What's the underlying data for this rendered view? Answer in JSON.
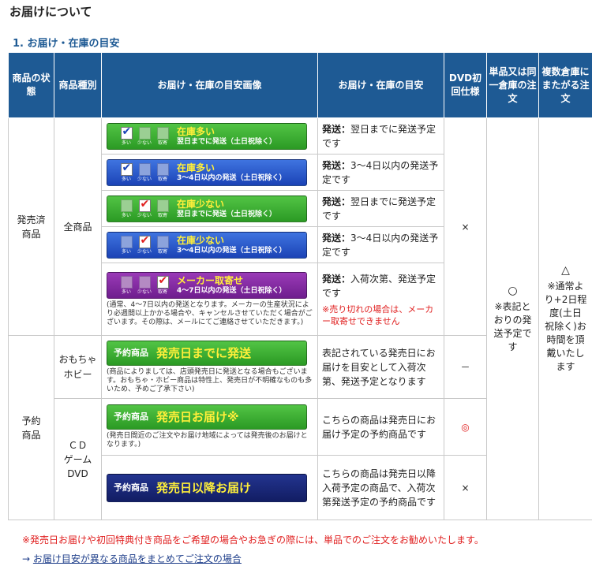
{
  "page": {
    "title": "お届けについて",
    "section_title": "1. お届け・在庫の目安"
  },
  "header": {
    "status": "商品の状態",
    "category": "商品種別",
    "image": "お届け・在庫の目安画像",
    "guide": "お届け・在庫の目安",
    "dvd": "DVD初回仕様",
    "single": "単品又は同一倉庫の注文",
    "multi": "複数倉庫にまたがる注文"
  },
  "released": {
    "status": "発売済商品",
    "category": "全商品",
    "box_labels": [
      "多い",
      "少ない",
      "取寄"
    ],
    "rows": [
      {
        "badge_main": "在庫多い",
        "badge_sub": "翌日までに発送（土日祝除く）",
        "desc_bold": "発送：",
        "desc": "翌日までに発送予定です"
      },
      {
        "badge_main": "在庫多い",
        "badge_sub": "3～4日以内の発送（土日祝除く）",
        "desc_bold": "発送：",
        "desc": "3～4日以内の発送予定です"
      },
      {
        "badge_main": "在庫少ない",
        "badge_sub": "翌日までに発送（土日祝除く）",
        "desc_bold": "発送：",
        "desc": "翌日までに発送予定です"
      },
      {
        "badge_main": "在庫少ない",
        "badge_sub": "3～4日以内の発送（土日祝除く）",
        "desc_bold": "発送：",
        "desc": "3～4日以内の発送予定です"
      },
      {
        "badge_main": "メーカー取寄せ",
        "badge_sub": "4～7日以内の発送（土日祝除く）",
        "desc_bold": "発送：",
        "desc": "入荷次第、発送予定です",
        "note": "(通常、4～7日以内の発送となります。メーカーの生産状況により必週間以上かかる場合や、キャンセルさせていただく場合がございます。その際は、メールにてご連絡させていただきます。)",
        "red": "※売り切れの場合は、メーカー取寄せできません"
      }
    ],
    "dvd": "×",
    "single": "○\n※表記とおりの発送予定です",
    "multi": "△\n※通常より+2日程度(土日祝除く)お時間を頂戴いたします"
  },
  "preorder": {
    "status": "予約商品",
    "rows": [
      {
        "category": "おもちゃ\nホビー",
        "badge_pre": "予約商品",
        "badge_main": "発売日までに発送",
        "note": "(商品によりましては、店頭発売日に発送となる場合もございます。おもちゃ・ホビー商品は特性上、発売日が不明確なものも多いため、予めご了承下さい)",
        "desc": "表記されている発売日にお届けを目安として入荷次第、発送予定となります",
        "dvd": "－"
      },
      {
        "category": "ＣＤ\nゲーム\nDVD",
        "badge_pre": "予約商品",
        "badge_main": "発売日お届け※",
        "note": "(発売日間近のご注文やお届け地域によっては発売後のお届けとなります。)",
        "desc": "こちらの商品は発売日にお届け予定の予約商品です",
        "dvd": "◎"
      },
      {
        "badge_pre": "予約商品",
        "badge_main": "発売日以降お届け",
        "desc": "こちらの商品は発売日以降入荷予定の商品で、入荷次第発送予定の予約商品です",
        "dvd": "×"
      }
    ]
  },
  "footer": {
    "note": "※発売日お届けや初回特典付き商品をご希望の場合やお急ぎの際には、単品でのご注文をお勧めいたします。",
    "link_arrow": "→",
    "link_text": "お届け目安が異なる商品をまとめてご注文の場合"
  },
  "colors": {
    "header_bg": "#1e5a94",
    "green": "#2b9a24",
    "blue": "#1b43b6",
    "purple": "#6f1e8e",
    "navy": "#121d63",
    "accent_yellow": "#ffef3a",
    "red": "#e02020"
  }
}
